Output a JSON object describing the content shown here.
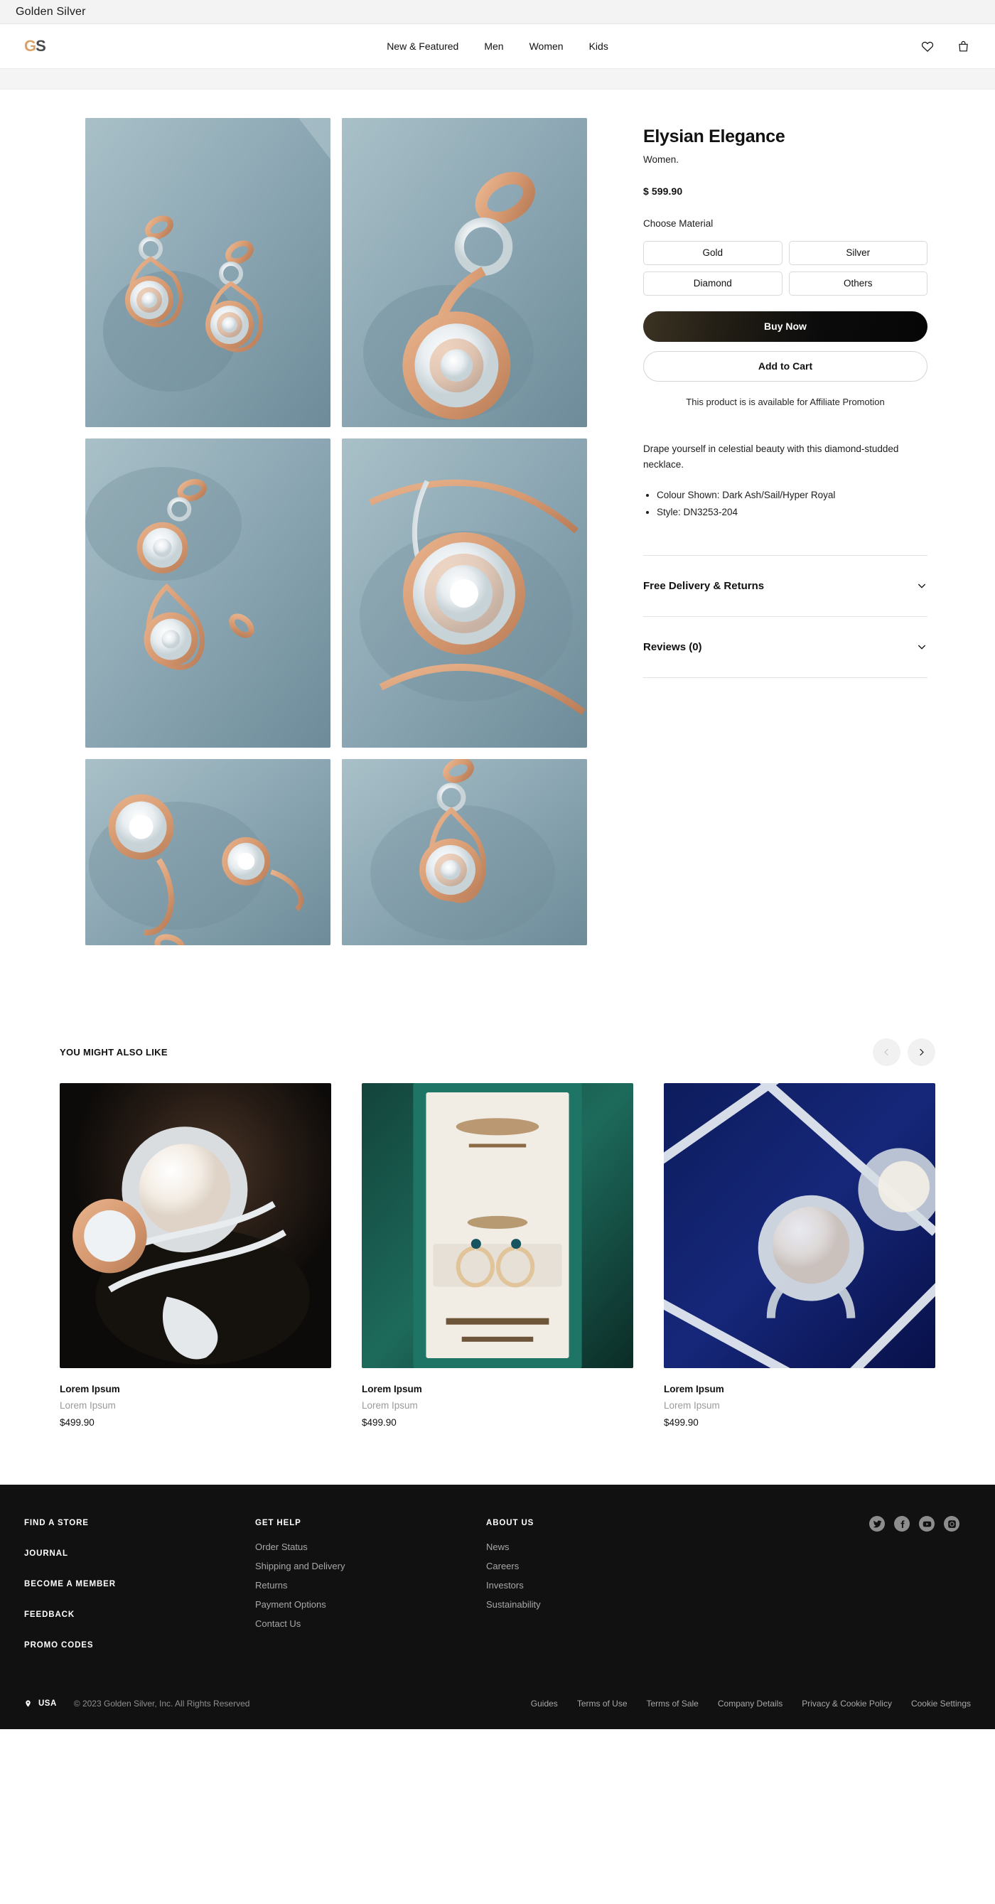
{
  "window": {
    "title": "Golden Silver"
  },
  "header": {
    "logo": {
      "part1": "G",
      "part2": "S"
    },
    "nav": [
      {
        "label": "New & Featured"
      },
      {
        "label": "Men"
      },
      {
        "label": "Women"
      },
      {
        "label": "Kids"
      }
    ],
    "icons": [
      {
        "name": "heart-icon"
      },
      {
        "name": "bag-icon"
      }
    ]
  },
  "product": {
    "title": "Elysian Elegance",
    "category": "Women.",
    "price": "$ 599.90",
    "choose_material_label": "Choose Material",
    "materials": [
      {
        "label": "Gold"
      },
      {
        "label": "Silver"
      },
      {
        "label": "Diamond"
      },
      {
        "label": "Others"
      }
    ],
    "buy_now_label": "Buy Now",
    "add_to_cart_label": "Add to Cart",
    "affiliate_note": "This product is is available for Affiliate Promotion",
    "description": "Drape yourself in celestial beauty with this diamond-studded necklace.",
    "bullets": [
      "Colour Shown: Dark Ash/Sail/Hyper Royal",
      "Style: DN3253-204"
    ],
    "accordions": [
      {
        "title": "Free Delivery & Returns",
        "icon": "chevron-down-icon"
      },
      {
        "title": "Reviews (0)",
        "icon": "chevron-down-icon"
      }
    ],
    "gallery_alt": [
      "Rose gold diamond drop earrings pair on blue textured surface",
      "Close-up of earring clasp and diamond pave loop",
      "Angled view of both diamond drop earrings",
      "Macro detail of circular diamond cluster",
      "Overhead view of two earrings on blue fabric",
      "Single earring full length on blue backdrop"
    ]
  },
  "recommendations": {
    "title": "YOU MIGHT ALSO LIKE",
    "prev_icon": "chevron-left-icon",
    "next_icon": "chevron-right-icon",
    "items": [
      {
        "name": "Lorem Ipsum",
        "subtitle": "Lorem Ipsum",
        "price": "$499.90"
      },
      {
        "name": "Lorem Ipsum",
        "subtitle": "Lorem Ipsum",
        "price": "$499.90"
      },
      {
        "name": "Lorem Ipsum",
        "subtitle": "Lorem Ipsum",
        "price": "$499.90"
      }
    ]
  },
  "footer": {
    "primary_links": [
      {
        "label": "FIND A STORE"
      },
      {
        "label": "JOURNAL"
      },
      {
        "label": "BECOME A MEMBER"
      },
      {
        "label": "FEEDBACK"
      },
      {
        "label": "PROMO CODES"
      }
    ],
    "columns": [
      {
        "heading": "GET HELP",
        "links": [
          {
            "label": "Order Status"
          },
          {
            "label": "Shipping and Delivery"
          },
          {
            "label": "Returns"
          },
          {
            "label": "Payment Options"
          },
          {
            "label": "Contact Us"
          }
        ]
      },
      {
        "heading": "ABOUT US",
        "links": [
          {
            "label": "News"
          },
          {
            "label": "Careers"
          },
          {
            "label": "Investors"
          },
          {
            "label": "Sustainability"
          }
        ]
      }
    ],
    "social": [
      {
        "name": "twitter-icon"
      },
      {
        "name": "facebook-icon"
      },
      {
        "name": "youtube-icon"
      },
      {
        "name": "instagram-icon"
      }
    ],
    "country": "USA",
    "copyright": "© 2023 Golden Silver, Inc. All Rights Reserved",
    "legal": [
      {
        "label": "Guides"
      },
      {
        "label": "Terms of Use"
      },
      {
        "label": "Terms of Sale"
      },
      {
        "label": "Company Details"
      },
      {
        "label": "Privacy & Cookie Policy"
      },
      {
        "label": "Cookie Settings"
      }
    ]
  },
  "colors": {
    "accent_gold": "#d9a36a",
    "cta_dark": "#0b0b0b",
    "footer_bg": "#111111",
    "muted_text": "#a8a8a8",
    "photo_bg_blue": "#8fa9b4"
  }
}
